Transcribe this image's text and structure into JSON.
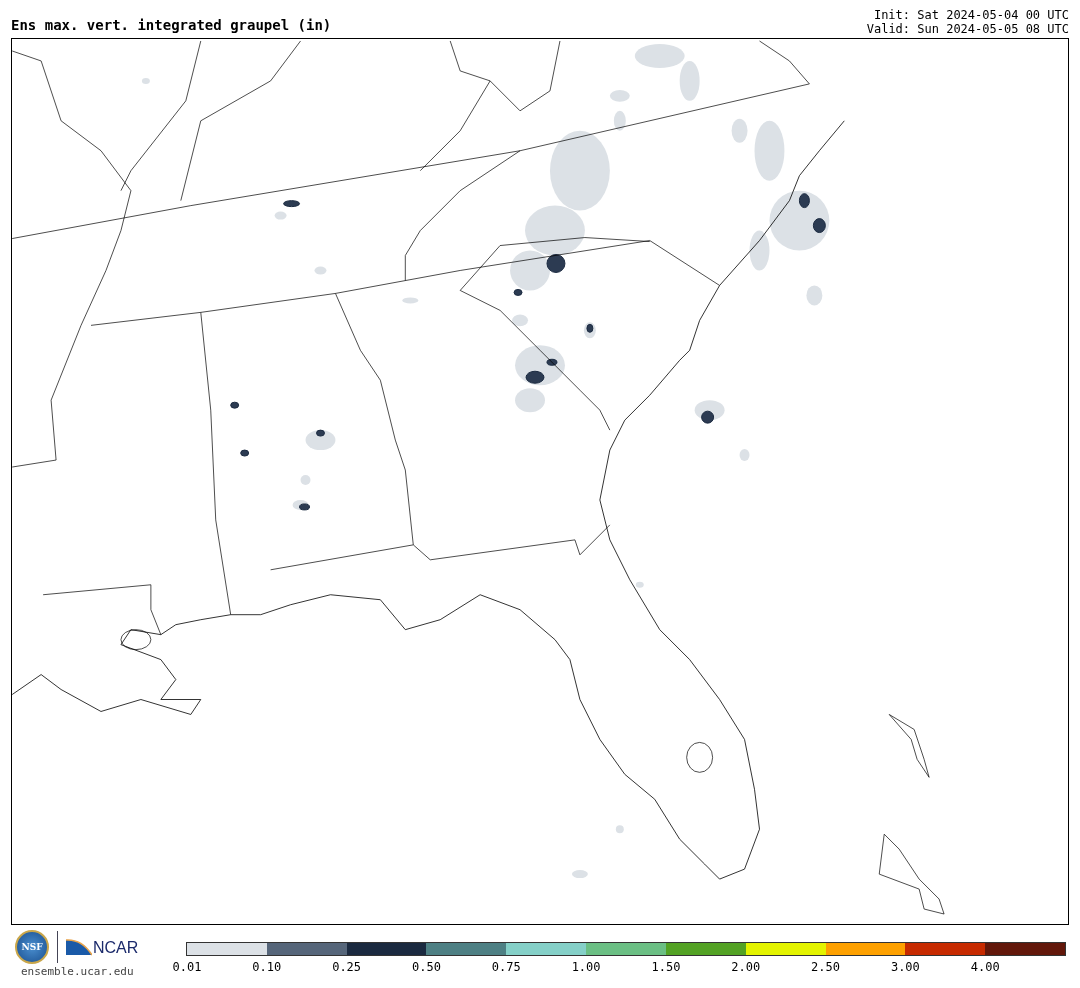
{
  "title": "Ens max. vert. integrated graupel (in)",
  "init": "Init: Sat 2024-05-04 00 UTC",
  "valid": "Valid: Sun 2024-05-05 08 UTC",
  "logos": {
    "ncar": "NCAR",
    "nsf": "NSF",
    "url": "ensemble.ucar.edu"
  },
  "colorbar": [
    {
      "label": "0.01",
      "color": "#dce1e6"
    },
    {
      "label": "0.10",
      "color": "#56667a"
    },
    {
      "label": "0.25",
      "color": "#1b2a40"
    },
    {
      "label": "0.50",
      "color": "#4e8084"
    },
    {
      "label": "0.75",
      "color": "#85d0c8"
    },
    {
      "label": "1.00",
      "color": "#6bbf84"
    },
    {
      "label": "1.50",
      "color": "#53a224"
    },
    {
      "label": "2.00",
      "color": "#e3f300"
    },
    {
      "label": "2.50",
      "color": "#fda000"
    },
    {
      "label": "3.00",
      "color": "#c62a00"
    },
    {
      "label": "4.00",
      "color": "#62170a"
    }
  ]
}
